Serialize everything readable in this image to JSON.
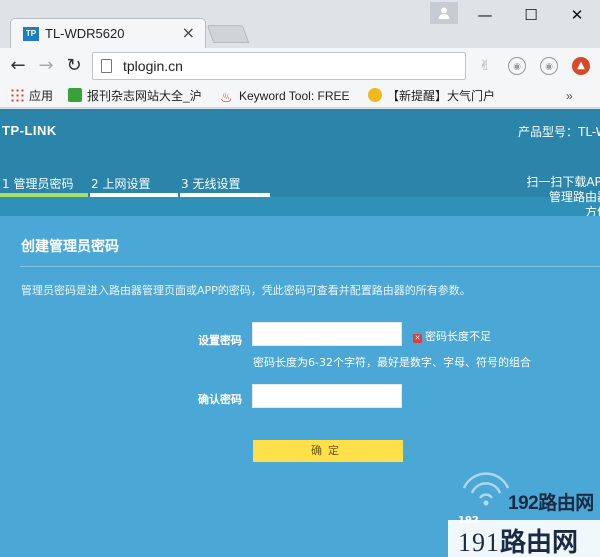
{
  "browser": {
    "tab_title": "TL-WDR5620",
    "tab_favicon": "TP",
    "url": "tplogin.cn",
    "new_tab": "",
    "bookmarks": [
      {
        "label": "应用",
        "icon": "apps-grid-icon"
      },
      {
        "label": "报刊杂志网站大全_沪",
        "icon": "green-check-icon"
      },
      {
        "label": "Keyword Tool: FREE",
        "icon": "flame-icon"
      },
      {
        "label": "【新提醒】大气门户",
        "icon": "trophy-icon"
      }
    ],
    "bookmarks_more": "»"
  },
  "router": {
    "logo": "TP-LINK",
    "model": "产品型号：TL-W",
    "steps": [
      "1 管理员密码",
      "2 上网设置",
      "3 无线设置"
    ],
    "active_step": 0,
    "qr_text": "扫一扫下载APP\n管理路由器\n方便",
    "section_title": "创建管理员密码",
    "description": "管理员密码是进入路由器管理页面或APP的密码，凭此密码可查看并配置路由器的所有参数。",
    "password_label": "设置密码",
    "password_value": "",
    "error_text": "密码长度不足",
    "hint": "密码长度为6-32个字符，最好是数字、字母、符号的组合",
    "confirm_label": "确认密码",
    "confirm_value": "",
    "confirm_button": "确定"
  },
  "watermark": {
    "top": "192路由网",
    "tiny": "192",
    "bottom_num": "191",
    "bottom_text": "路由网"
  },
  "colors": {
    "page_bg": "#2f90b8",
    "card_bg": "#4aa7d6",
    "active_step_bar": "#a8e063",
    "button_bg": "#ffe04a",
    "error_icon": "#e53935"
  }
}
